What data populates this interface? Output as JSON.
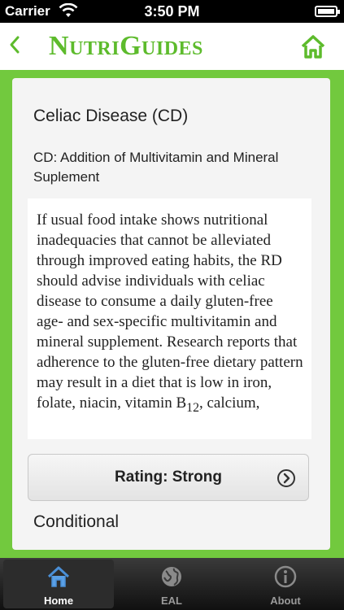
{
  "status_bar": {
    "carrier": "Carrier",
    "time": "3:50 PM"
  },
  "nav": {
    "logo_first": "N",
    "logo_first_rest": "UTRI",
    "logo_second": "G",
    "logo_second_rest": "UIDES"
  },
  "content": {
    "title": "Celiac Disease (CD)",
    "subtitle": "CD: Addition of Multivitamin and Mineral Suplement",
    "body_main": "If usual food intake shows nutritional inadequacies that cannot be alleviated through improved eating habits, the RD should advise individuals with celiac disease to consume a daily gluten-free age- and sex-specific multivitamin and mineral supplement. Research reports that adherence to the gluten-free dietary pattern may result in a diet that is low in iron, folate, niacin, vitamin B",
    "body_sub": "12",
    "body_tail": ", calcium,",
    "rating_label": "Rating: Strong",
    "conditional_label": "Conditional"
  },
  "tabs": [
    {
      "label": "Home",
      "icon": "home-icon",
      "active": true
    },
    {
      "label": "EAL",
      "icon": "globe-icon",
      "active": false
    },
    {
      "label": "About",
      "icon": "info-icon",
      "active": false
    }
  ],
  "colors": {
    "brand_green": "#5dbb2c",
    "frame_green": "#72c93e"
  }
}
